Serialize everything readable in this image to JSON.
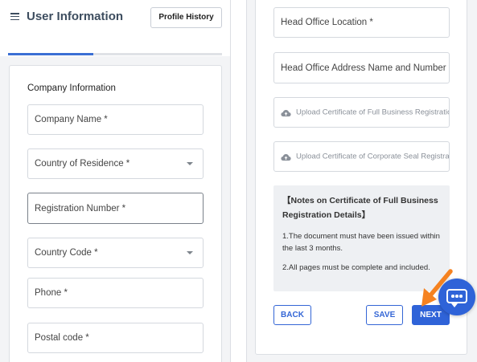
{
  "header": {
    "title": "User Information",
    "profile_history_label": "Profile History",
    "menu_icon": "hamburger-menu-icon"
  },
  "progress": {
    "fraction": 0.4
  },
  "company_section": {
    "title": "Company Information",
    "fields": {
      "company_name": "Company Name *",
      "country_of_residence": "Country of Residence *",
      "registration_number": "Registration Number *",
      "country_code": "Country Code *",
      "phone": "Phone *",
      "postal_code": "Postal code *"
    }
  },
  "address_fields": {
    "head_office_location": "Head Office Location *",
    "head_office_address": "Head Office Address Name and Number *"
  },
  "uploads": {
    "full_business_registration": "Upload  Certificate of Full Business Registration Details",
    "corporate_seal": "Upload  Certificate of Corporate Seal Registration",
    "upload_icon": "cloud-upload-icon"
  },
  "notes": {
    "title": "【Notes on Certificate of Full Business Registration Details】",
    "line1": "1.The document must have been issued within the last 3 months.",
    "line2": "2.All pages must be complete and included."
  },
  "actions": {
    "back_label": "BACK",
    "save_label": "SAVE",
    "next_label": "NEXT"
  },
  "chat": {
    "icon": "chat-bubble-icon"
  },
  "annotation": {
    "icon": "arrow-pointer-icon"
  },
  "colors": {
    "accent": "#2f63d8",
    "progress": "#3b6fd4",
    "arrow": "#f58220",
    "background": "#f3f4f6"
  }
}
